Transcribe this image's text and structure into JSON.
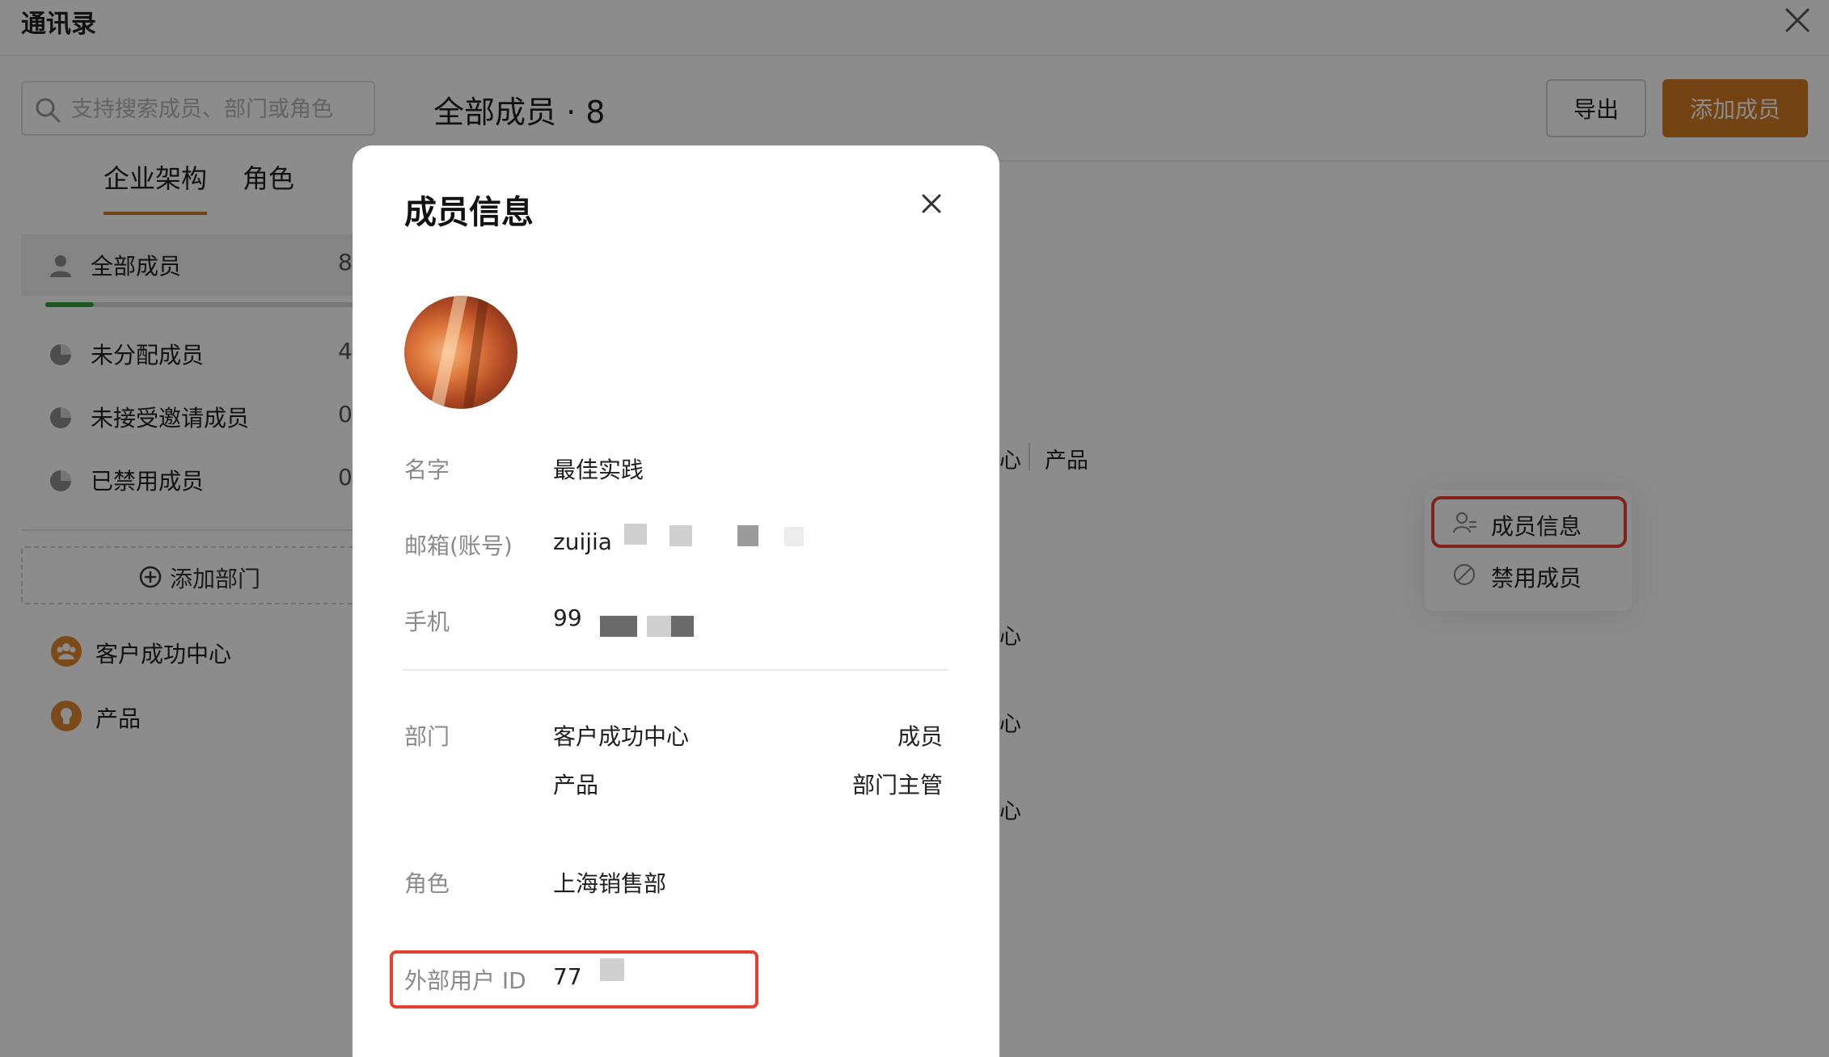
{
  "window": {
    "title": "通讯录"
  },
  "search": {
    "placeholder": "支持搜索成员、部门或角色"
  },
  "tabs": [
    {
      "label": "企业架构",
      "active": true
    },
    {
      "label": "角色",
      "active": false
    }
  ],
  "left_items": [
    {
      "label": "全部成员",
      "count": "8",
      "icon": "user-icon"
    },
    {
      "label": "未分配成员",
      "count": "4",
      "icon": "pie-icon"
    },
    {
      "label": "未接受邀请成员",
      "count": "0",
      "icon": "pie-icon"
    },
    {
      "label": "已禁用成员",
      "count": "0",
      "icon": "pie-icon"
    }
  ],
  "add_department": {
    "label": "添加部门"
  },
  "departments": [
    {
      "label": "客户成功中心",
      "icon": "team-icon"
    },
    {
      "label": "产品",
      "icon": "bulb-icon"
    }
  ],
  "main": {
    "title": "全部成员 · 8",
    "export_label": "导出",
    "add_member_label": "添加成员",
    "background_cells": [
      "心",
      "产品",
      "心",
      "心",
      "心"
    ]
  },
  "context_menu": {
    "items": [
      {
        "label": "成员信息",
        "icon": "user-info-icon",
        "highlighted": true
      },
      {
        "label": "禁用成员",
        "icon": "ban-icon",
        "highlighted": false
      }
    ]
  },
  "modal": {
    "title": "成员信息",
    "fields": {
      "name": {
        "label": "名字",
        "value": "最佳实践"
      },
      "email": {
        "label": "邮箱(账号)",
        "value": "zuijia"
      },
      "phone": {
        "label": "手机",
        "value": "99"
      },
      "department": {
        "label": "部门",
        "rows": [
          {
            "name": "客户成功中心",
            "role": "成员"
          },
          {
            "name": "产品",
            "role": "部门主管"
          }
        ]
      },
      "role": {
        "label": "角色",
        "value": "上海销售部"
      },
      "external_id": {
        "label": "外部用户 ID",
        "value": "77"
      }
    }
  },
  "colors": {
    "accent": "#d27a25",
    "tab_underline": "#c27a2c",
    "active_progress": "#2e9d42",
    "highlight_box": "#e8402f",
    "overlay": "rgba(0,0,0,0.45)"
  }
}
